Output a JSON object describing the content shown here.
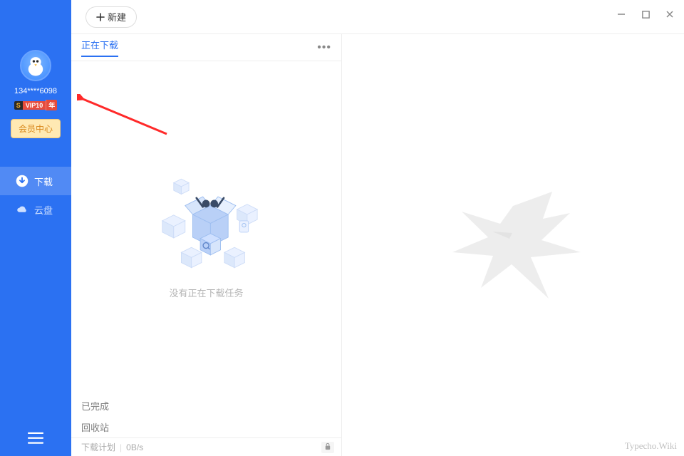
{
  "sidebar": {
    "username": "134****6098",
    "vip_s": "S",
    "vip_middle": "VIP10",
    "vip_suffix": "年",
    "member_button": "会员中心",
    "nav": [
      {
        "label": "下载",
        "icon": "download-icon",
        "active": true
      },
      {
        "label": "云盘",
        "icon": "cloud-icon",
        "active": false
      }
    ]
  },
  "titlebar": {
    "new_button": "新建"
  },
  "left_panel": {
    "active_tab": "正在下载",
    "empty_text": "没有正在下载任务",
    "bottom": {
      "completed": "已完成",
      "recycle": "回收站",
      "plan_label": "下载计划",
      "plan_speed": "0B/s"
    }
  },
  "watermark": "Typecho.Wiki"
}
